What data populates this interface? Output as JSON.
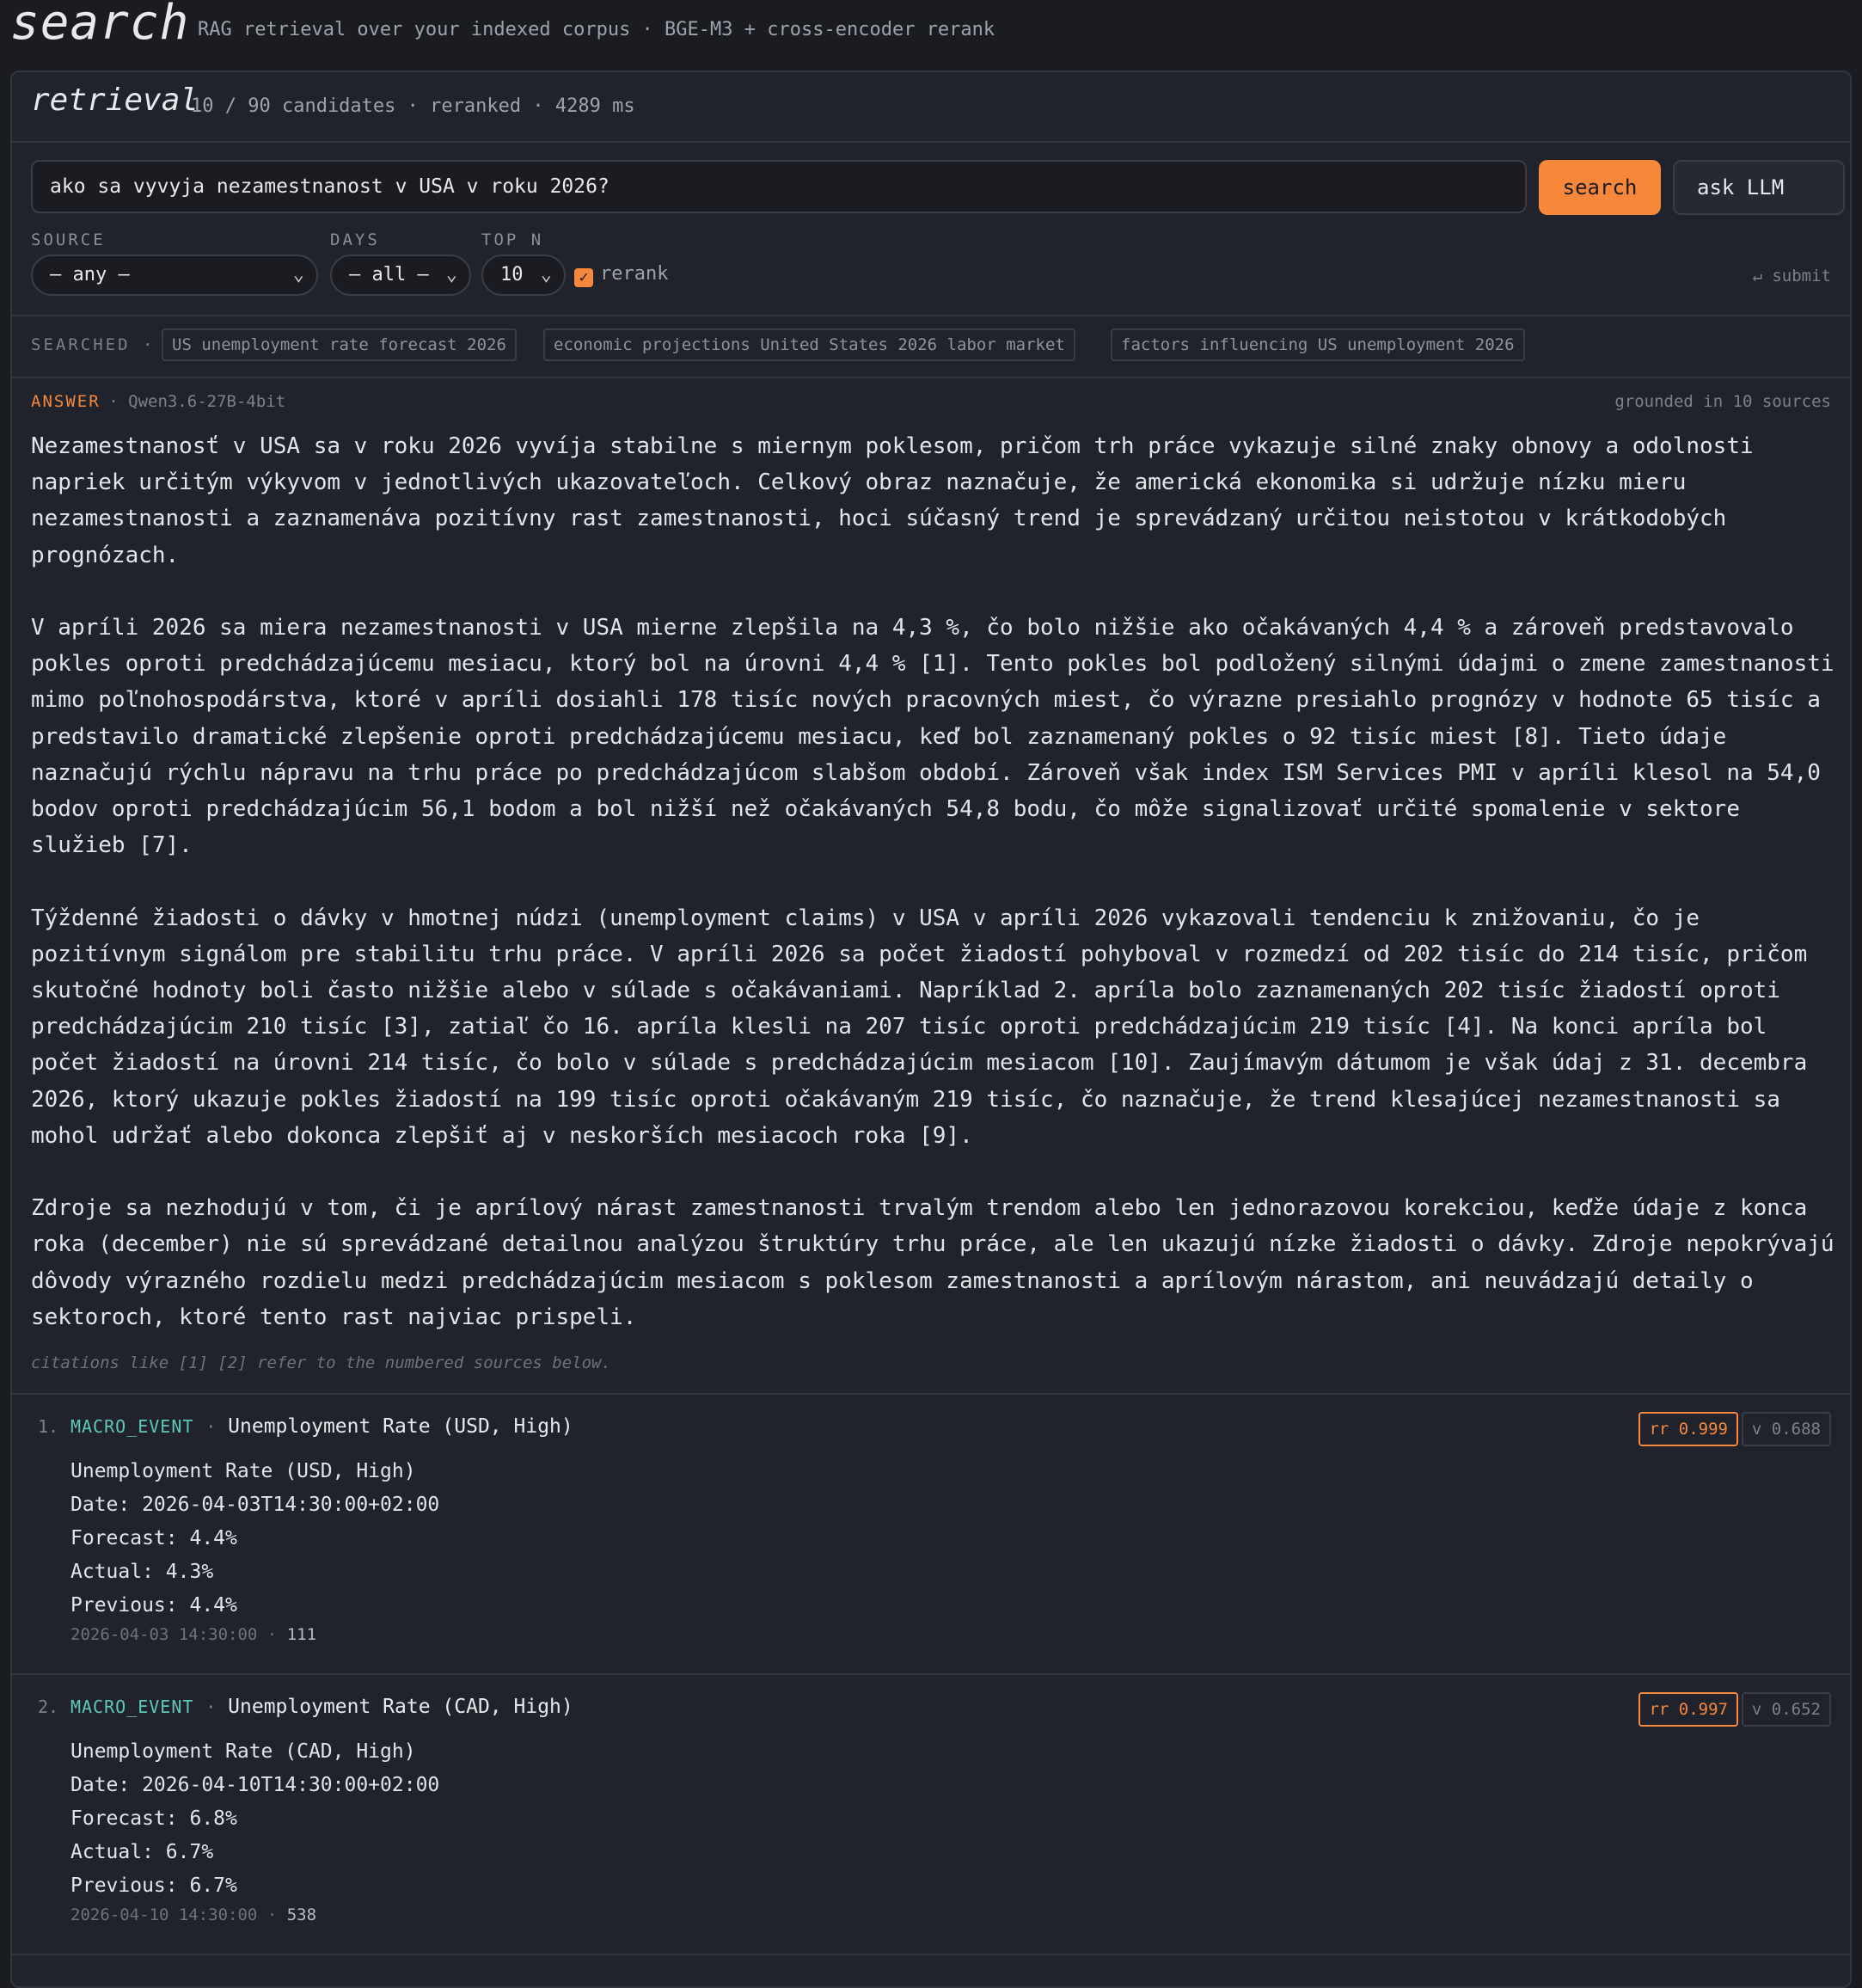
{
  "app": {
    "title": "search",
    "tagline": "RAG retrieval over your indexed corpus · BGE-M3 + cross-encoder rerank"
  },
  "panel": {
    "title": "retrieval",
    "meta": "10 / 90 candidates · reranked · 4289 ms"
  },
  "query": {
    "value": "ako sa vyvyja nezamestnanost v USA v roku 2026?",
    "search_label": "search",
    "ask_label": "ask LLM"
  },
  "filters": {
    "source_label": "SOURCE",
    "source_value": "— any —",
    "days_label": "DAYS",
    "days_value": "— all —",
    "topn_label": "TOP N",
    "topn_value": "10",
    "rerank_label": "rerank",
    "rerank_checked": true,
    "submit_hint": "↵ submit"
  },
  "searched": {
    "label": "SEARCHED ·",
    "queries": [
      "US unemployment rate forecast 2026",
      "economic projections United States 2026 labor market",
      "factors influencing US unemployment 2026"
    ]
  },
  "answer": {
    "label": "ANSWER",
    "model": "· Qwen3.6-27B-4bit",
    "grounded": "grounded in 10 sources",
    "paragraphs": [
      "Nezamestnanosť v USA sa v roku 2026 vyvíja stabilne s miernym poklesom, pričom trh práce vykazuje silné znaky obnovy a odolnosti napriek určitým výkyvom v jednotlivých ukazovateľoch. Celkový obraz naznačuje, že americká ekonomika si udržuje nízku mieru nezamestnanosti a zaznamenáva pozitívny rast zamestnanosti, hoci súčasný trend je sprevádzaný určitou neistotou v krátkodobých prognózach.",
      "V apríli 2026 sa miera nezamestnanosti v USA mierne zlepšila na 4,3 %, čo bolo nižšie ako očakávaných 4,4 % a zároveň predstavovalo pokles oproti predchádzajúcemu mesiacu, ktorý bol na úrovni 4,4 % [1]. Tento pokles bol podložený silnými údajmi o zmene zamestnanosti mimo poľnohospodárstva, ktoré v apríli dosiahli 178 tisíc nových pracovných miest, čo výrazne presiahlo prognózy v hodnote 65 tisíc a predstavilo dramatické zlepšenie oproti predchádzajúcemu mesiacu, keď bol zaznamenaný pokles o 92 tisíc miest [8]. Tieto údaje naznačujú rýchlu nápravu na trhu práce po predchádzajúcom slabšom období. Zároveň však index ISM Services PMI v apríli klesol na 54,0 bodov oproti predchádzajúcim 56,1 bodom a bol nižší než očakávaných 54,8 bodu, čo môže signalizovať určité spomalenie v sektore služieb [7].",
      "Týždenné žiadosti o dávky v hmotnej núdzi (unemployment claims) v USA v apríli 2026 vykazovali tendenciu k znižovaniu, čo je pozitívnym signálom pre stabilitu trhu práce. V apríli 2026 sa počet žiadostí pohyboval v rozmedzí od 202 tisíc do 214 tisíc, pričom skutočné hodnoty boli často nižšie alebo v súlade s očakávaniami. Napríklad 2. apríla bolo zaznamenaných 202 tisíc žiadostí oproti predchádzajúcim 210 tisíc [3], zatiaľ čo 16. apríla klesli na 207 tisíc oproti predchádzajúcim 219 tisíc [4]. Na konci apríla bol počet žiadostí na úrovni 214 tisíc, čo bolo v súlade s predchádzajúcim mesiacom [10]. Zaujímavým dátumom je však údaj z 31. decembra 2026, ktorý ukazuje pokles žiadostí na 199 tisíc oproti očakávaným 219 tisíc, čo naznačuje, že trend klesajúcej nezamestnanosti sa mohol udržať alebo dokonca zlepšiť aj v neskorších mesiacoch roka [9].",
      "Zdroje sa nezhodujú v tom, či je aprílový nárast zamestnanosti trvalým trendom alebo len jednorazovou korekciou, keďže údaje z konca roka (december) nie sú sprevádzané detailnou analýzou štruktúry trhu práce, ale len ukazujú nízke žiadosti o dávky. Zdroje nepokrývajú dôvody výrazného rozdielu medzi predchádzajúcim mesiacom s poklesom zamestnanosti a aprílovým nárastom, ani neuvádzajú detaily o sektoroch, ktoré tento rast najviac prispeli."
    ],
    "note": "citations like [1] [2] refer to the numbered sources below."
  },
  "results": [
    {
      "num": "1.",
      "source": "MACRO_EVENT",
      "title": "Unemployment Rate (USD, High)",
      "rr": "rr 0.999",
      "v": "v 0.688",
      "lines": [
        "Unemployment Rate (USD, High)",
        "Date: 2026-04-03T14:30:00+02:00",
        "Forecast: 4.4%",
        "Actual: 4.3%",
        "Previous: 4.4%"
      ],
      "date": "2026-04-03 14:30:00",
      "count": "111"
    },
    {
      "num": "2.",
      "source": "MACRO_EVENT",
      "title": "Unemployment Rate (CAD, High)",
      "rr": "rr 0.997",
      "v": "v 0.652",
      "lines": [
        "Unemployment Rate (CAD, High)",
        "Date: 2026-04-10T14:30:00+02:00",
        "Forecast: 6.8%",
        "Actual: 6.7%",
        "Previous: 6.7%"
      ],
      "date": "2026-04-10 14:30:00",
      "count": "538"
    }
  ],
  "colors": {
    "accent": "#f7873a",
    "source_tag": "#5ec8b8",
    "background": "#1a1c22",
    "panel": "#20232b"
  }
}
